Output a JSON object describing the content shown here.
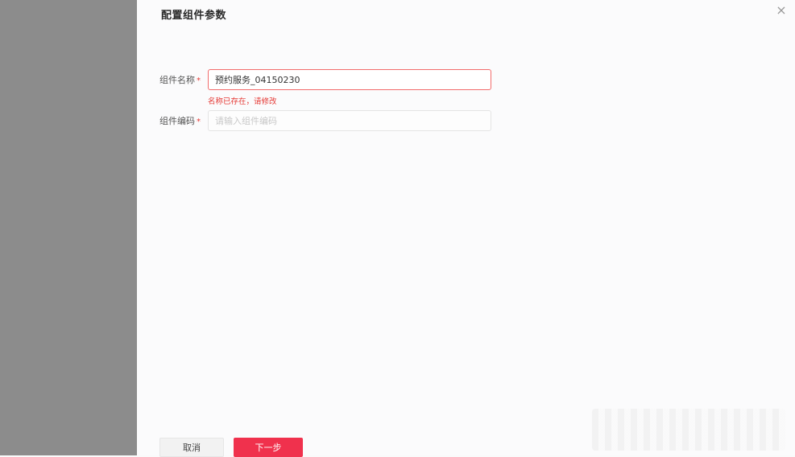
{
  "drawer": {
    "title": "配置组件参数",
    "close_icon": "×"
  },
  "form": {
    "name": {
      "label": "组件名称",
      "required": "*",
      "value": "预约服务_04150230",
      "error": "名称已存在，请修改"
    },
    "code": {
      "label": "组件编码",
      "required": "*",
      "value": "",
      "placeholder": "请输入组件编码"
    }
  },
  "footer": {
    "cancel_label": "取消",
    "next_label": "下一步"
  },
  "colors": {
    "accent": "#f0314d",
    "error": "#e53935",
    "overlay": "#8c8c8c"
  }
}
